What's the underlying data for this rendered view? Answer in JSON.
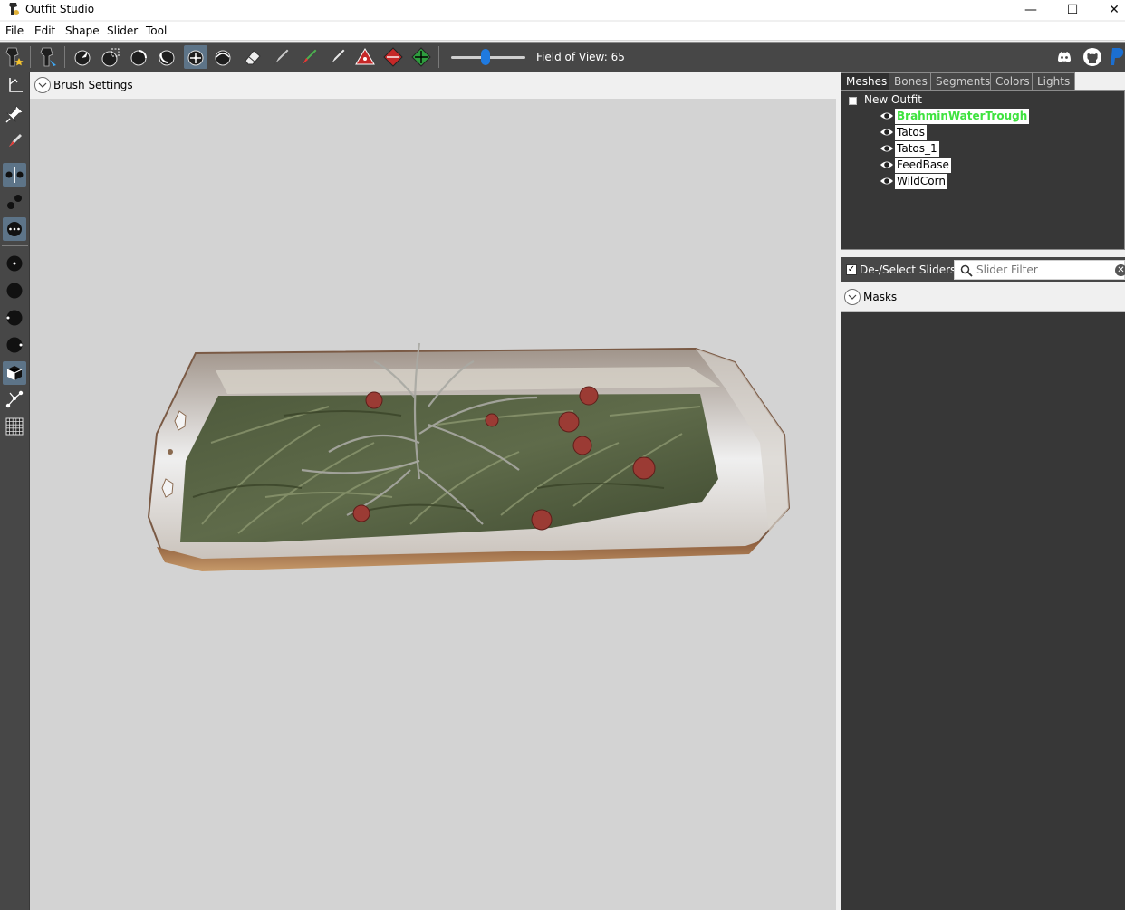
{
  "window": {
    "title": "Outfit Studio",
    "controls": {
      "minimize": "—",
      "maximize": "☐",
      "close": "✕"
    }
  },
  "menu": [
    "File",
    "Edit",
    "Shape",
    "Slider",
    "Tool"
  ],
  "toolbar": {
    "icons": [
      "outfit-star-icon",
      "outfit-brush-icon",
      "pointer-icon",
      "select-rect-icon",
      "inflate-brush-icon",
      "deflate-brush-icon",
      "move-brush-icon",
      "smooth-brush-icon",
      "eraser-icon",
      "weight-brush-icon",
      "color-brush-icon",
      "alpha-brush-icon",
      "collapse-vertex-icon",
      "flip-edge-icon",
      "split-edge-icon"
    ],
    "field_of_view_label": "Field of View: 65",
    "field_of_view_value": 65,
    "external_icons": [
      "discord-icon",
      "github-icon",
      "paypal-icon"
    ]
  },
  "brush": {
    "settings_label": "Brush Settings"
  },
  "tabs": [
    "Meshes",
    "Bones",
    "Segments",
    "Colors",
    "Lights"
  ],
  "selected_tab": "Meshes",
  "meshes": {
    "root": "New Outfit",
    "items": [
      "BrahminWaterTrough",
      "Tatos",
      "Tatos_1",
      "FeedBase",
      "WildCorn"
    ],
    "selected": "BrahminWaterTrough"
  },
  "sliders": {
    "deselect_label": "De-/Select Sliders",
    "deselect_checked": true,
    "filter_placeholder": "Slider Filter",
    "masks_label": "Masks"
  },
  "colors": {
    "toolbar_bg": "#474747",
    "active_tool": "#5d7488",
    "viewport_bg": "#d3d3d3",
    "selected_mesh_text": "#3ee23e",
    "panel_dark": "#373737"
  }
}
